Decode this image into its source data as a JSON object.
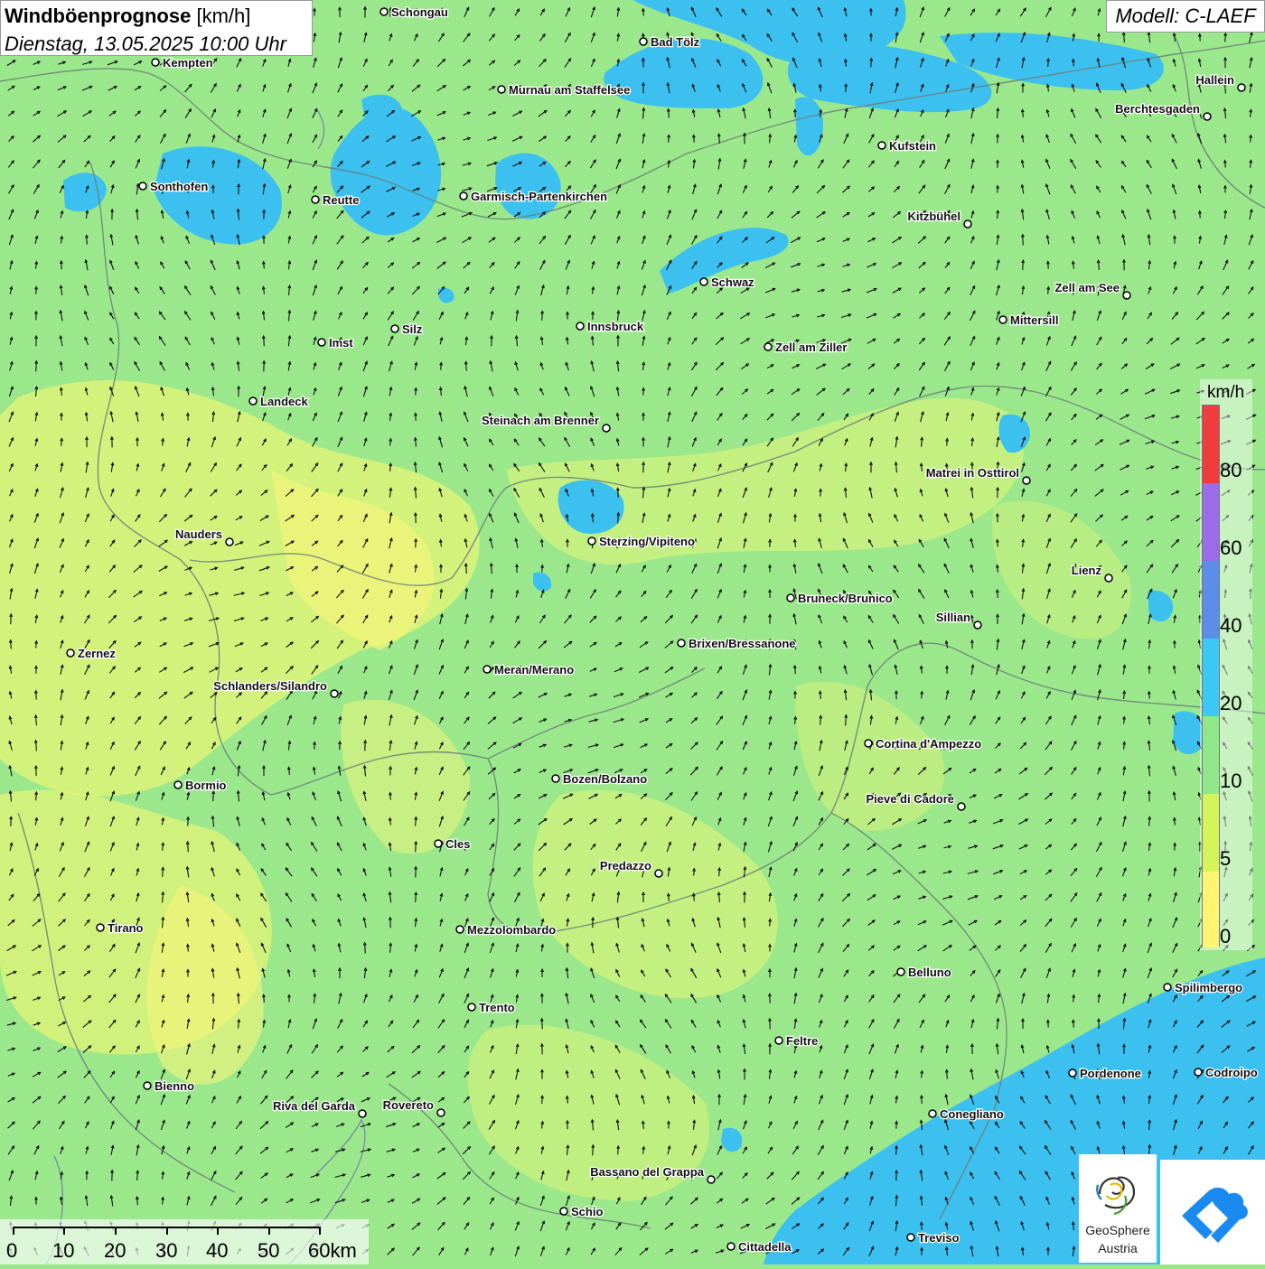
{
  "title": {
    "main": "Windböenprognose",
    "unit": "[km/h]",
    "date": "Dienstag, 13.05.2025 10:00 Uhr"
  },
  "model": "Modell: C-LAEF",
  "legend": {
    "unit": "km/h",
    "labels": [
      "80",
      "60",
      "40",
      "20",
      "10",
      "5",
      "0"
    ],
    "colors": {
      "0-5": "#fff570",
      "5-10": "#d4f55a",
      "10-20": "#8ee88a",
      "20-40": "#3cc0f0",
      "40-60": "#5a8ee8",
      "60-80": "#9a6ce8",
      "80+": "#f03c3c"
    }
  },
  "scale": {
    "labels": [
      "0",
      "10",
      "20",
      "30",
      "40",
      "50",
      "60km"
    ]
  },
  "logos": {
    "geosphere_line1": "GeoSphere",
    "geosphere_line2": "Austria",
    "geosphere_icon": "geosphere-swirl-icon",
    "app_icon": "warnings-app-icon"
  },
  "cities": [
    {
      "name": "Schongau",
      "side": "right"
    },
    {
      "name": "Kempten",
      "side": "right"
    },
    {
      "name": "Bad Tölz",
      "side": "right"
    },
    {
      "name": "Murnau am Staffelsee",
      "side": "right"
    },
    {
      "name": "Hallein",
      "side": "left"
    },
    {
      "name": "Berchtesgaden",
      "side": "left"
    },
    {
      "name": "Kufstein",
      "side": "right"
    },
    {
      "name": "Sonthofen",
      "side": "right"
    },
    {
      "name": "Reutte",
      "side": "right"
    },
    {
      "name": "Garmisch-Partenkirchen",
      "side": "right"
    },
    {
      "name": "Kitzbühel",
      "side": "left"
    },
    {
      "name": "Schwaz",
      "side": "right"
    },
    {
      "name": "Zell am See",
      "side": "left"
    },
    {
      "name": "Mittersill",
      "side": "right"
    },
    {
      "name": "Innsbruck",
      "side": "right"
    },
    {
      "name": "Silz",
      "side": "right"
    },
    {
      "name": "Imst",
      "side": "right"
    },
    {
      "name": "Zell am Ziller",
      "side": "right"
    },
    {
      "name": "Landeck",
      "side": "right"
    },
    {
      "name": "Steinach am Brenner",
      "side": "left"
    },
    {
      "name": "Matrei in Osttirol",
      "side": "left"
    },
    {
      "name": "Nauders",
      "side": "left"
    },
    {
      "name": "Sterzing/Vipiteno",
      "side": "right"
    },
    {
      "name": "Lienz",
      "side": "left"
    },
    {
      "name": "Bruneck/Brunico",
      "side": "right"
    },
    {
      "name": "Sillian",
      "side": "left"
    },
    {
      "name": "Zernez",
      "side": "right"
    },
    {
      "name": "Brixen/Bressanone",
      "side": "right"
    },
    {
      "name": "Meran/Merano",
      "side": "right"
    },
    {
      "name": "Schlanders/Silandro",
      "side": "left"
    },
    {
      "name": "Cortina d'Ampezzo",
      "side": "right"
    },
    {
      "name": "Bozen/Bolzano",
      "side": "right"
    },
    {
      "name": "Bormio",
      "side": "right"
    },
    {
      "name": "Pieve di Cadore",
      "side": "left"
    },
    {
      "name": "Cles",
      "side": "right"
    },
    {
      "name": "Predazzo",
      "side": "left"
    },
    {
      "name": "Tirano",
      "side": "right"
    },
    {
      "name": "Mezzolombardo",
      "side": "right"
    },
    {
      "name": "Belluno",
      "side": "right"
    },
    {
      "name": "Spilimbergo",
      "side": "right"
    },
    {
      "name": "Trento",
      "side": "right"
    },
    {
      "name": "Feltre",
      "side": "right"
    },
    {
      "name": "Pordenone",
      "side": "right"
    },
    {
      "name": "Codroipo",
      "side": "right"
    },
    {
      "name": "Bienno",
      "side": "right"
    },
    {
      "name": "Riva del Garda",
      "side": "left"
    },
    {
      "name": "Rovereto",
      "side": "left"
    },
    {
      "name": "Conegliano",
      "side": "right"
    },
    {
      "name": "Bassano del Grappa",
      "side": "left"
    },
    {
      "name": "Schio",
      "side": "right"
    },
    {
      "name": "Treviso",
      "side": "right"
    },
    {
      "name": "Cittadella",
      "side": "right"
    }
  ]
}
